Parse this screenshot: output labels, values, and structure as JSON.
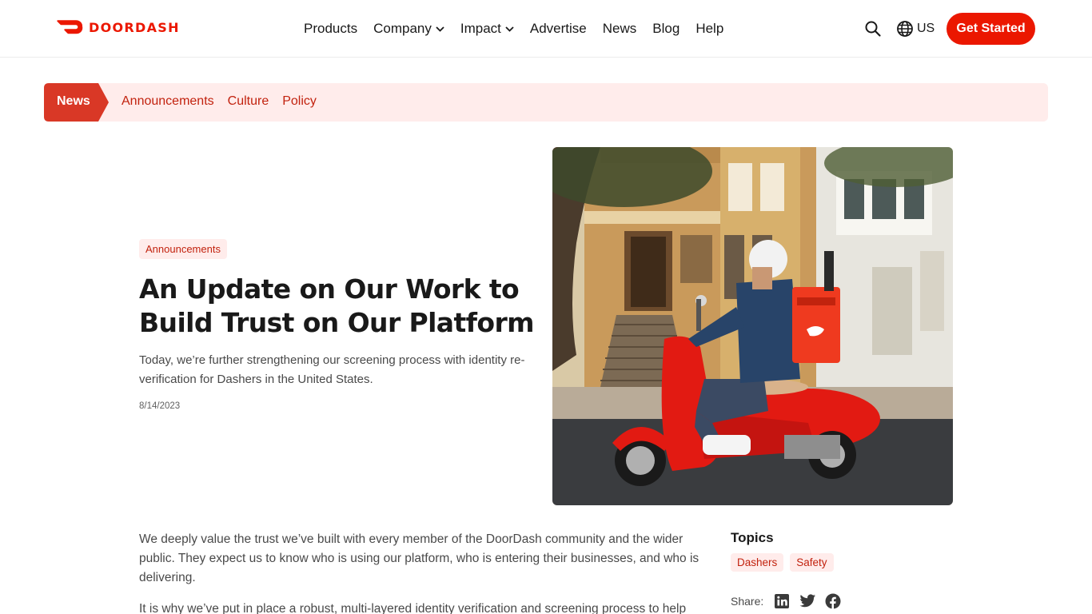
{
  "header": {
    "logo_text": "DOORDASH",
    "nav": [
      {
        "label": "Products",
        "dropdown": false
      },
      {
        "label": "Company",
        "dropdown": true
      },
      {
        "label": "Impact",
        "dropdown": true
      },
      {
        "label": "Advertise",
        "dropdown": false
      },
      {
        "label": "News",
        "dropdown": false
      },
      {
        "label": "Blog",
        "dropdown": false
      },
      {
        "label": "Help",
        "dropdown": false
      }
    ],
    "locale": "US",
    "cta": "Get Started",
    "search_icon": "search-icon",
    "globe_icon": "globe-icon"
  },
  "category_bar": {
    "active": "News",
    "links": [
      "Announcements",
      "Culture",
      "Policy"
    ]
  },
  "hero": {
    "category": "Announcements",
    "title": "An Update on Our Work to Build Trust on Our Platform",
    "subtitle": "Today, we’re further strengthening our screening process with identity re-verification for Dashers in the United States.",
    "date": "8/14/2023",
    "image": "photo-dasher-on-red-scooter"
  },
  "article": {
    "paragraphs": [
      "We deeply value the trust we’ve built with every member of the DoorDash community and the wider public. They expect us to know who is using our platform, who is entering their businesses, and who is delivering.",
      "It is why we’ve put in place a robust, multi-layered identity verification and screening process to help"
    ]
  },
  "sidebar": {
    "topics_title": "Topics",
    "topics": [
      "Dashers",
      "Safety"
    ],
    "share_label": "Share:",
    "share_icons": [
      "linkedin-icon",
      "twitter-icon",
      "facebook-icon"
    ]
  },
  "colors": {
    "brand_red": "#eb1700",
    "link_red": "#c2220e",
    "pill_bg": "#ffeceb",
    "text_dark": "#191919",
    "text_gray": "#494949"
  }
}
